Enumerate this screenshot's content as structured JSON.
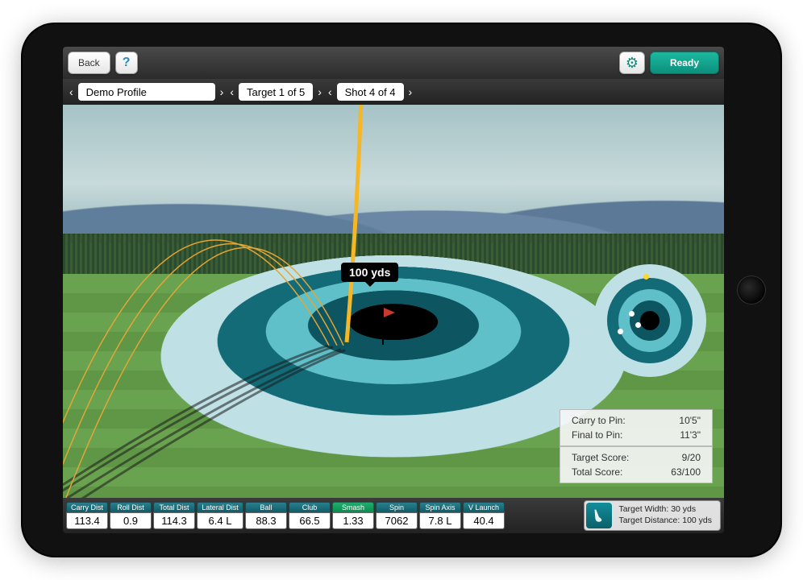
{
  "topbar": {
    "back_label": "Back",
    "ready_label": "Ready"
  },
  "selectors": {
    "profile": "Demo Profile",
    "target": "Target 1 of 5",
    "shot": "Shot 4 of 4"
  },
  "scene": {
    "distance_label": "100 yds"
  },
  "results1": {
    "carry_to_pin_label": "Carry to Pin:",
    "carry_to_pin_value": "10'5\"",
    "final_to_pin_label": "Final to Pin:",
    "final_to_pin_value": "11'3\""
  },
  "results2": {
    "target_score_label": "Target Score:",
    "target_score_value": "9/20",
    "total_score_label": "Total Score:",
    "total_score_value": "63/100"
  },
  "metrics": [
    {
      "label": "Carry Dist",
      "value": "113.4",
      "green": false
    },
    {
      "label": "Roll Dist",
      "value": "0.9",
      "green": false
    },
    {
      "label": "Total Dist",
      "value": "114.3",
      "green": false
    },
    {
      "label": "Lateral Dist",
      "value": "6.4 L",
      "green": false
    },
    {
      "label": "Ball",
      "value": "88.3",
      "green": false
    },
    {
      "label": "Club",
      "value": "66.5",
      "green": false
    },
    {
      "label": "Smash",
      "value": "1.33",
      "green": true
    },
    {
      "label": "Spin",
      "value": "7062",
      "green": false
    },
    {
      "label": "Spin Axis",
      "value": "7.8 L",
      "green": false
    },
    {
      "label": "V Launch",
      "value": "40.4",
      "green": false
    }
  ],
  "target_info": {
    "width_line": "Target Width: 30 yds",
    "distance_line": "Target Distance: 100 yds"
  }
}
